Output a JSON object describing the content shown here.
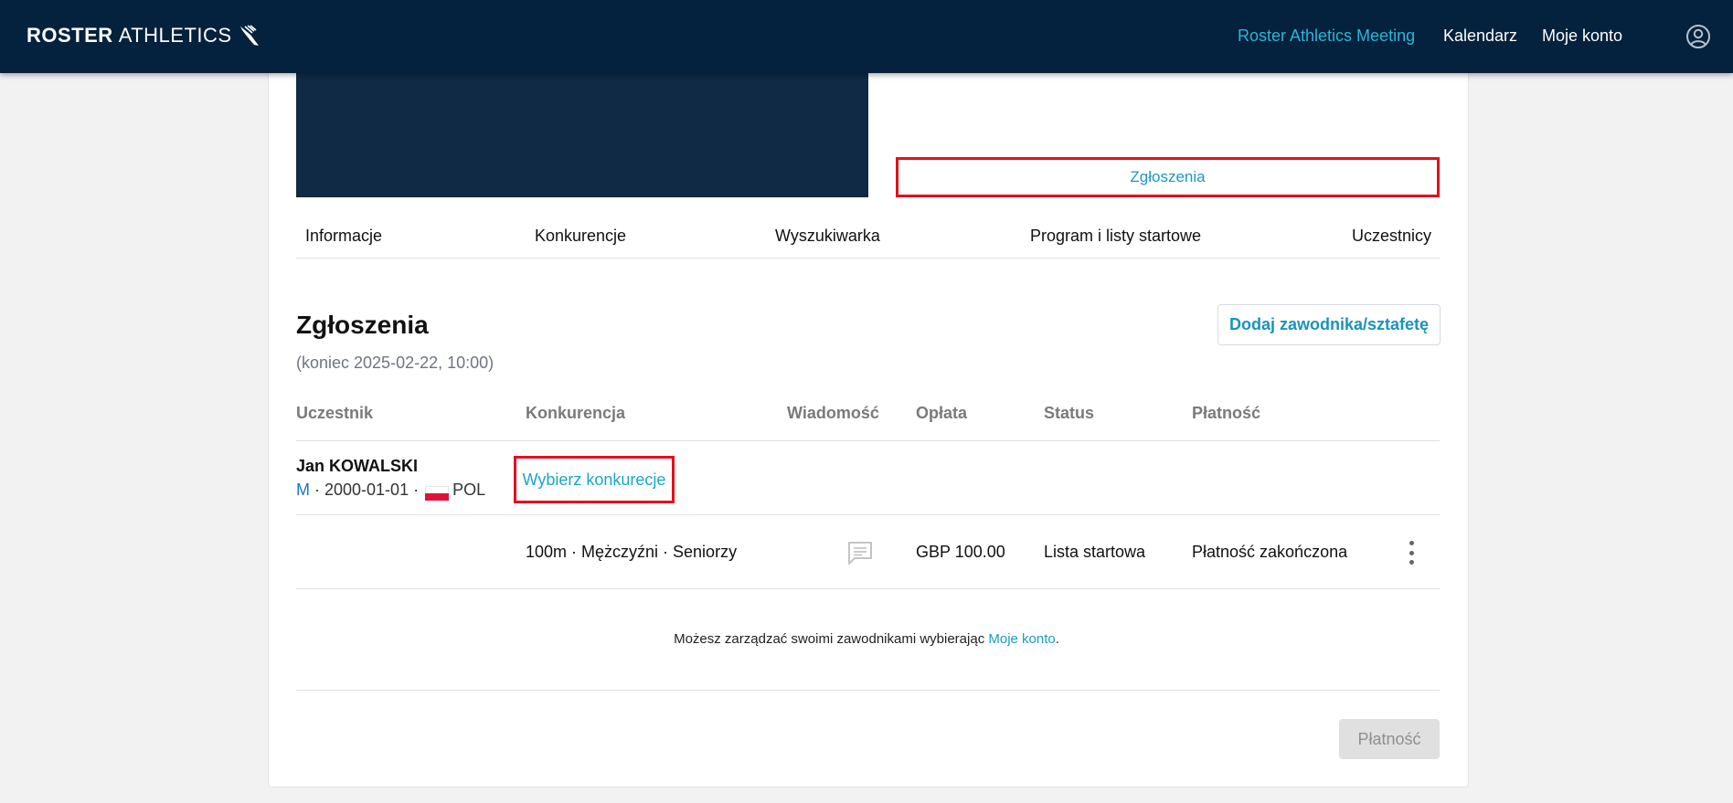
{
  "header": {
    "brand_bold": "ROSTER",
    "brand_light": "ATHLETICS",
    "nav": [
      {
        "label": "Roster Athletics Meeting",
        "active": true
      },
      {
        "label": "Kalendarz",
        "active": false
      },
      {
        "label": "Moje konto",
        "active": false
      }
    ],
    "bg_color": "#04213d",
    "accent_color": "#29b6d8"
  },
  "event": {
    "entries_button": "Zgłoszenia",
    "tabs": [
      "Informacje",
      "Konkurencje",
      "Wyszukiwarka",
      "Program i listy startowe",
      "Uczestnicy"
    ]
  },
  "entries": {
    "title": "Zgłoszenia",
    "deadline": "(koniec 2025-02-22, 10:00)",
    "add_button": "Dodaj zawodnika/sztafetę",
    "columns": [
      "Uczestnik",
      "Konkurencja",
      "Wiadomość",
      "Opłata",
      "Status",
      "Płatność"
    ],
    "athlete": {
      "name": "Jan KOWALSKI",
      "sex": "M",
      "birthdate": "2000-01-01",
      "sep": " · ",
      "country": "POL",
      "choose_event": "Wybierz konkurecje"
    },
    "rows": [
      {
        "event": "100m · Mężczyźni · Seniorzy",
        "message_icon": "chat-icon",
        "fee": "GBP 100.00",
        "status": "Lista startowa",
        "payment": "Płatność zakończona"
      }
    ],
    "manage_text": "Możesz zarządzać swoimi zawodnikami wybierając",
    "manage_link": "Moje konto",
    "manage_end": ".",
    "pay_button": "Płatność"
  }
}
